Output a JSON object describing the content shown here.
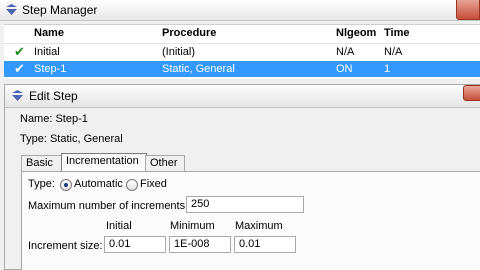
{
  "step_manager": {
    "title": "Step Manager",
    "columns": [
      "Name",
      "Procedure",
      "Nlgeom",
      "Time"
    ],
    "rows": [
      {
        "check": "✔",
        "name": "Initial",
        "procedure": "(Initial)",
        "nlgeom": "N/A",
        "time": "N/A"
      },
      {
        "check": "✔",
        "name": "Step-1",
        "procedure": "Static, General",
        "nlgeom": "ON",
        "time": "1",
        "selected": true
      }
    ],
    "selection_color": "#3399ff"
  },
  "edit_step": {
    "title": "Edit Step",
    "name_line": "Name:  Step-1",
    "type_line": "Type:  Static, General",
    "tabs": [
      "Basic",
      "Incrementation",
      "Other"
    ],
    "active_tab": "Incrementation",
    "type_label": "Type:",
    "type_options": [
      "Automatic",
      "Fixed"
    ],
    "type_selected": "Automatic",
    "max_increments_label": "Maximum number of increments:",
    "max_increments_value": "250",
    "increment_headers": [
      "Initial",
      "Minimum",
      "Maximum"
    ],
    "increment_size_label": "Increment size:",
    "increment_values": [
      "0.01",
      "1E-008",
      "0.01"
    ]
  }
}
